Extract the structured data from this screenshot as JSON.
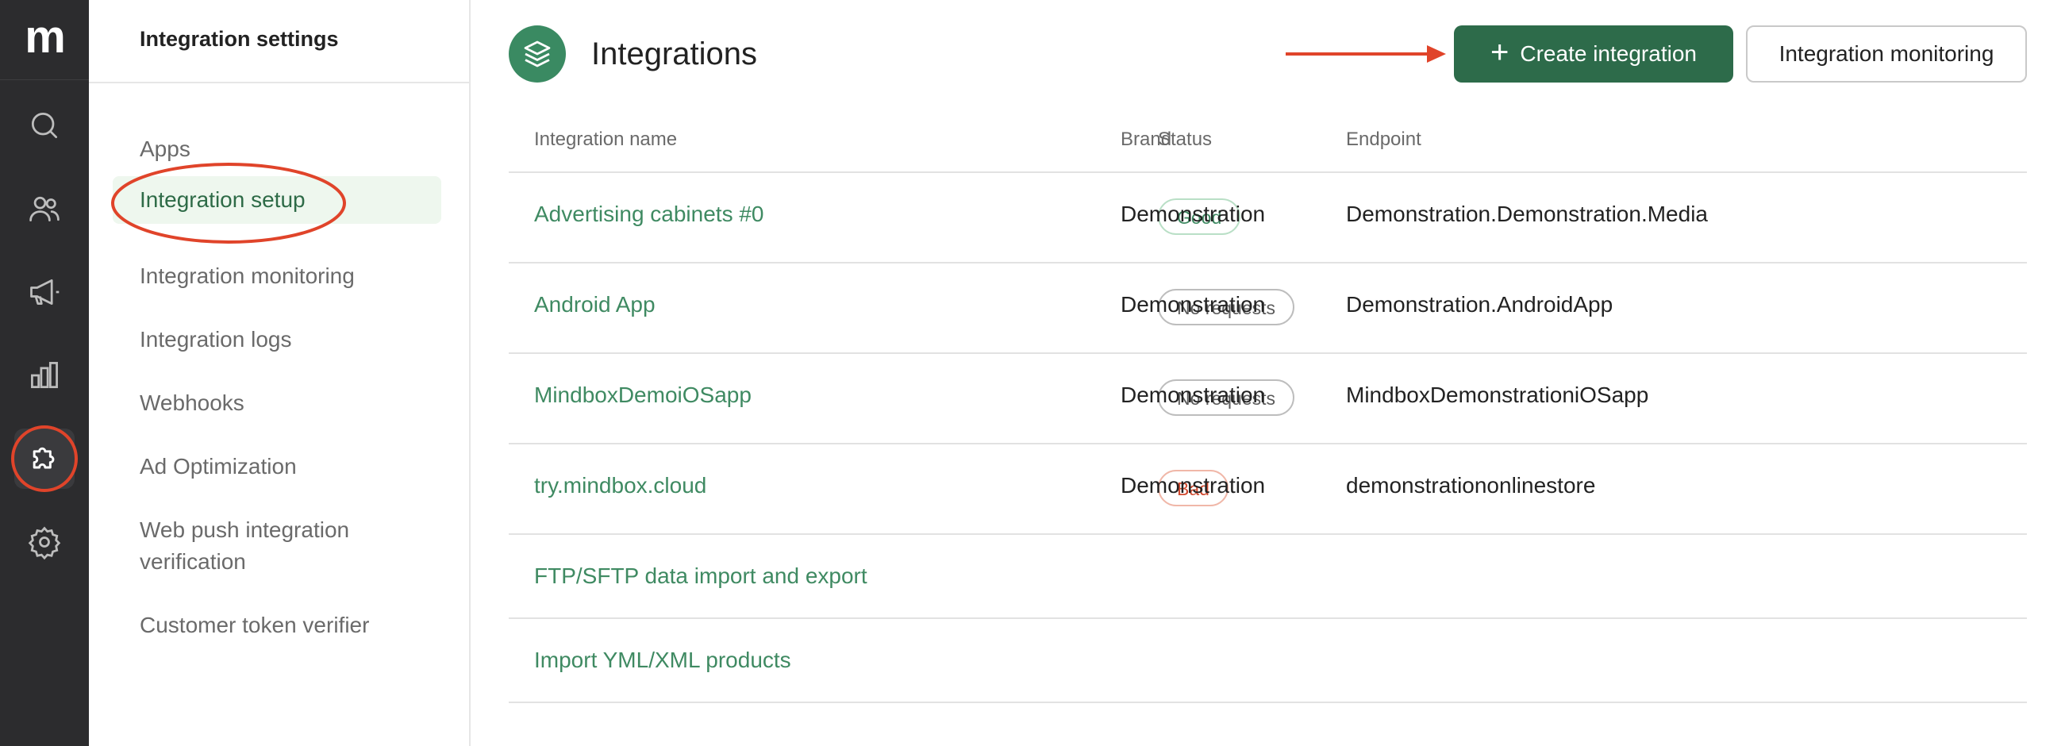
{
  "app": {
    "logo_text": "m"
  },
  "rail": {
    "items": [
      {
        "icon": "search-icon",
        "name": "search"
      },
      {
        "icon": "users-icon",
        "name": "customers"
      },
      {
        "icon": "megaphone-icon",
        "name": "campaigns"
      },
      {
        "icon": "bar-chart-icon",
        "name": "analytics"
      },
      {
        "icon": "puzzle-icon",
        "name": "integrations",
        "active": true
      },
      {
        "icon": "gear-icon",
        "name": "settings"
      }
    ]
  },
  "sidebar": {
    "title": "Integration settings",
    "items": [
      {
        "label": "Apps"
      },
      {
        "label": "Integration setup",
        "active": true
      },
      {
        "label": "Integration monitoring"
      },
      {
        "label": "Integration logs"
      },
      {
        "label": "Webhooks"
      },
      {
        "label": "Ad Optimization"
      },
      {
        "label": "Web push integration verification"
      },
      {
        "label": "Customer token verifier"
      }
    ]
  },
  "header": {
    "icon": "layers-icon",
    "title": "Integrations",
    "create_label": "Create integration",
    "monitor_label": "Integration monitoring"
  },
  "table": {
    "columns": [
      "Integration name",
      "Status",
      "Brand",
      "Endpoint"
    ],
    "rows": [
      {
        "name": "Advertising cabinets #0",
        "status": "Good",
        "status_kind": "good",
        "brand": "Demonstration",
        "endpoint": "Demonstration.Demonstration.Media"
      },
      {
        "name": "Android App",
        "status": "No requests",
        "status_kind": "none",
        "brand": "Demonstration",
        "endpoint": "Demonstration.AndroidApp"
      },
      {
        "name": "MindboxDemoiOSapp",
        "status": "No requests",
        "status_kind": "none",
        "brand": "Demonstration",
        "endpoint": "MindboxDemonstrationiOSapp"
      },
      {
        "name": "try.mindbox.cloud",
        "status": "Bad",
        "status_kind": "bad",
        "brand": "Demonstration",
        "endpoint": "demonstrationonlinestore"
      },
      {
        "name": "FTP/SFTP data import and export"
      },
      {
        "name": "Import YML/XML products"
      }
    ]
  },
  "colors": {
    "rail_bg": "#2c2c2e",
    "brand_green": "#2d6b4a",
    "link_green": "#3f8a62",
    "active_bg": "#eef7ee",
    "annotation_red": "#e0442a"
  }
}
